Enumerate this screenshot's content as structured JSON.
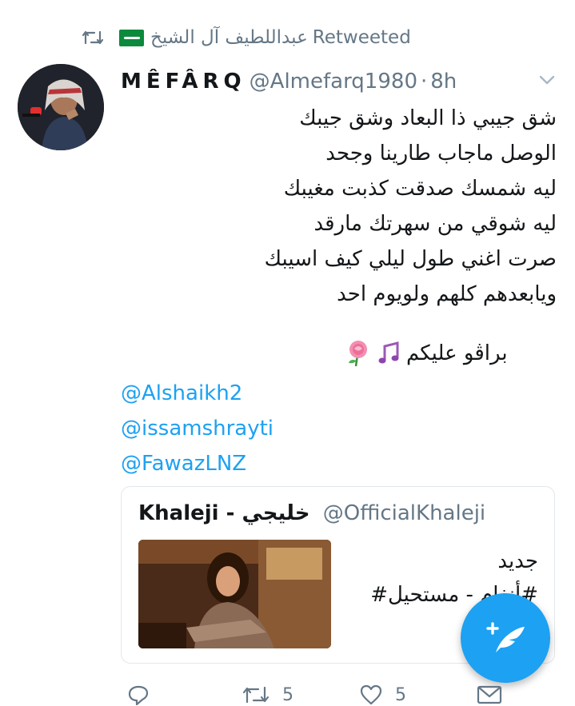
{
  "retweet": {
    "by_name": "عبداللطيف آل الشيخ",
    "label": "Retweeted",
    "flag_color": "#0b8a3c"
  },
  "tweet": {
    "display_name": "MÊFÂRQ",
    "handle": "@Almefarq1980",
    "separator": "·",
    "time": "8h",
    "lines": [
      "شق جيبي ذا البعاد وشق جيبك",
      "الوصل ماجاب طارينا وجحد",
      "ليه شمسك صدقت كذبت مغيبك",
      "ليه شوقي من سهرتك مارقد",
      "صرت اغني طول ليلي كيف اسيبك",
      "ويابعدهم كلهم ولويوم احد"
    ],
    "greeting": "براڤو عليكم",
    "greeting_emoji": [
      "musical-notes",
      "rose"
    ],
    "mentions": [
      "@Alshaikh2",
      "@issamshrayti",
      "@FawazLNZ"
    ]
  },
  "quoted": {
    "name": "Khaleji - خليجي",
    "handle": "@OfficialKhaleji",
    "text_lines": [
      "جديد",
      "#أنغام - مستحيل#",
      "..."
    ]
  },
  "actions": {
    "reply_count": "",
    "retweet_count": "5",
    "like_count": "5"
  },
  "colors": {
    "accent": "#1da1f2",
    "muted": "#657786",
    "text": "#14171a",
    "border": "#e1e8ed"
  }
}
